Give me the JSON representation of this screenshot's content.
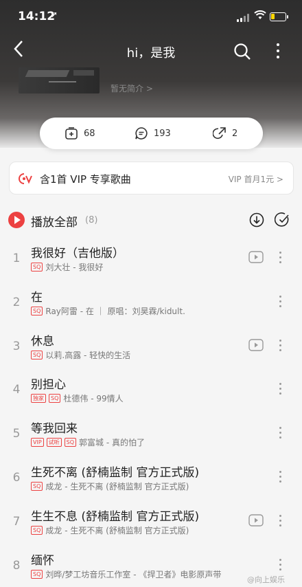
{
  "status": {
    "time": "14:12",
    "location_icon": "location-arrow-icon",
    "battery_color": "#ffd600",
    "battery_level": 0.25
  },
  "header": {
    "title": "hi，是我",
    "description": "暂无简介 >"
  },
  "actions": [
    {
      "icon": "add-folder-icon",
      "count": "68"
    },
    {
      "icon": "comment-icon",
      "count": "193"
    },
    {
      "icon": "share-icon",
      "count": "2"
    }
  ],
  "vip_banner": {
    "text": "含1首 VIP 专享歌曲",
    "right": "VIP 首月1元 >"
  },
  "play_all": {
    "label": "播放全部",
    "count": "(8)"
  },
  "accent_color": "#ec4141",
  "songs": [
    {
      "num": "1",
      "title": "我很好（吉他版）",
      "tags": [
        "SQ"
      ],
      "meta": "刘大壮 - 我很好",
      "video": true
    },
    {
      "num": "2",
      "title": "在",
      "tags": [
        "SQ"
      ],
      "meta": "Ray阿雷 - 在 ｜ 原唱：刘昊霖/kidult.",
      "video": false
    },
    {
      "num": "3",
      "title": "休息",
      "tags": [
        "SQ"
      ],
      "meta": "以莉.高露 - 轻快的生活",
      "video": true
    },
    {
      "num": "4",
      "title": "别担心",
      "tags": [
        "独家",
        "SQ"
      ],
      "meta": "杜德伟 - 99情人",
      "video": false
    },
    {
      "num": "5",
      "title": "等我回来",
      "tags": [
        "VIP",
        "试听",
        "SQ"
      ],
      "meta": "郭富城 - 真的怕了",
      "video": false
    },
    {
      "num": "6",
      "title": "生死不离 (舒楠监制 官方正式版)",
      "tags": [
        "SQ"
      ],
      "meta": "成龙 - 生死不离 (舒楠监制 官方正式版)",
      "video": false
    },
    {
      "num": "7",
      "title": "生生不息 (舒楠监制 官方正式版)",
      "tags": [
        "SQ"
      ],
      "meta": "成龙 - 生死不离 (舒楠监制 官方正式版)",
      "video": true
    },
    {
      "num": "8",
      "title": "缅怀",
      "tags": [
        "SQ"
      ],
      "meta": "刘晔/梦工坊音乐工作室 - 《捍卫者》电影原声带",
      "video": false
    }
  ],
  "watermark": "@向上娱乐"
}
